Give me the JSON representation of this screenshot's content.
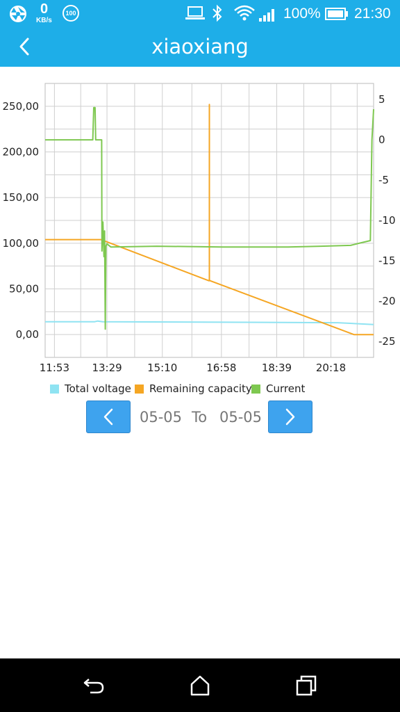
{
  "status_bar": {
    "net_speed": "0",
    "net_unit": "KB/s",
    "badge": "100",
    "battery": "100%",
    "time": "21:30"
  },
  "header": {
    "title": "xiaoxiang"
  },
  "icons": {
    "back": "chevron-left-icon",
    "prev": "chevron-left-icon",
    "next": "chevron-right-icon",
    "nav_back": "back-icon",
    "nav_home": "home-icon",
    "nav_recents": "recents-icon"
  },
  "colors": {
    "header": "#1eaee8",
    "voltage": "#8fe3f2",
    "capacity": "#f5a623",
    "current": "#7ec850",
    "button": "#3ea3ee"
  },
  "date_range": {
    "from": "05-05",
    "sep": "To",
    "to": "05-05"
  },
  "chart_data": {
    "type": "line",
    "x_tick_labels": [
      "11:53",
      "13:29",
      "15:10",
      "16:58",
      "18:39",
      "20:18"
    ],
    "x_ticks_hours": [
      11.883,
      13.483,
      15.167,
      16.967,
      18.65,
      20.3
    ],
    "x_range_hours": [
      11.6,
      21.6
    ],
    "y_left_ticks": [
      "0,00",
      "50,00",
      "100,00",
      "150,00",
      "200,00",
      "250,00"
    ],
    "y_left_range": [
      -25,
      275
    ],
    "y_right_ticks": [
      "5",
      "0",
      "-5",
      "-10",
      "-15",
      "-20",
      "-25"
    ],
    "y_right_range": [
      -27,
      7
    ],
    "grid": true,
    "legend_position": "bottom",
    "series": [
      {
        "name": "Total voltage",
        "axis": "left",
        "color": "#8fe3f2",
        "points": [
          [
            11.6,
            14
          ],
          [
            13.1,
            14
          ],
          [
            13.2,
            14.8
          ],
          [
            13.35,
            14
          ],
          [
            17.0,
            13.5
          ],
          [
            20.5,
            13
          ],
          [
            21.6,
            11
          ]
        ]
      },
      {
        "name": "Remaining capacity",
        "axis": "left",
        "color": "#f5a623",
        "points": [
          [
            11.6,
            104
          ],
          [
            13.1,
            104
          ],
          [
            13.3,
            104
          ],
          [
            16.58,
            59
          ],
          [
            16.6,
            59
          ],
          [
            16.6,
            252
          ],
          [
            16.6,
            60
          ],
          [
            16.62,
            59
          ],
          [
            21.0,
            0
          ],
          [
            21.6,
            0
          ]
        ]
      },
      {
        "name": "Current",
        "axis": "right",
        "color": "#7ec850",
        "points": [
          [
            11.6,
            0
          ],
          [
            13.05,
            0
          ],
          [
            13.08,
            4
          ],
          [
            13.12,
            4
          ],
          [
            13.14,
            0
          ],
          [
            13.32,
            0
          ],
          [
            13.33,
            -13.8
          ],
          [
            13.36,
            -10.2
          ],
          [
            13.39,
            -14.5
          ],
          [
            13.41,
            -11.3
          ],
          [
            13.43,
            -23.5
          ],
          [
            13.45,
            -13.2
          ],
          [
            13.48,
            -12.9
          ],
          [
            13.6,
            -13.3
          ],
          [
            15.0,
            -13.2
          ],
          [
            17.0,
            -13.3
          ],
          [
            19.0,
            -13.3
          ],
          [
            20.0,
            -13.2
          ],
          [
            20.9,
            -13.1
          ],
          [
            21.2,
            -12.8
          ],
          [
            21.5,
            -12.5
          ],
          [
            21.55,
            0
          ],
          [
            21.6,
            3.8
          ]
        ]
      }
    ]
  }
}
